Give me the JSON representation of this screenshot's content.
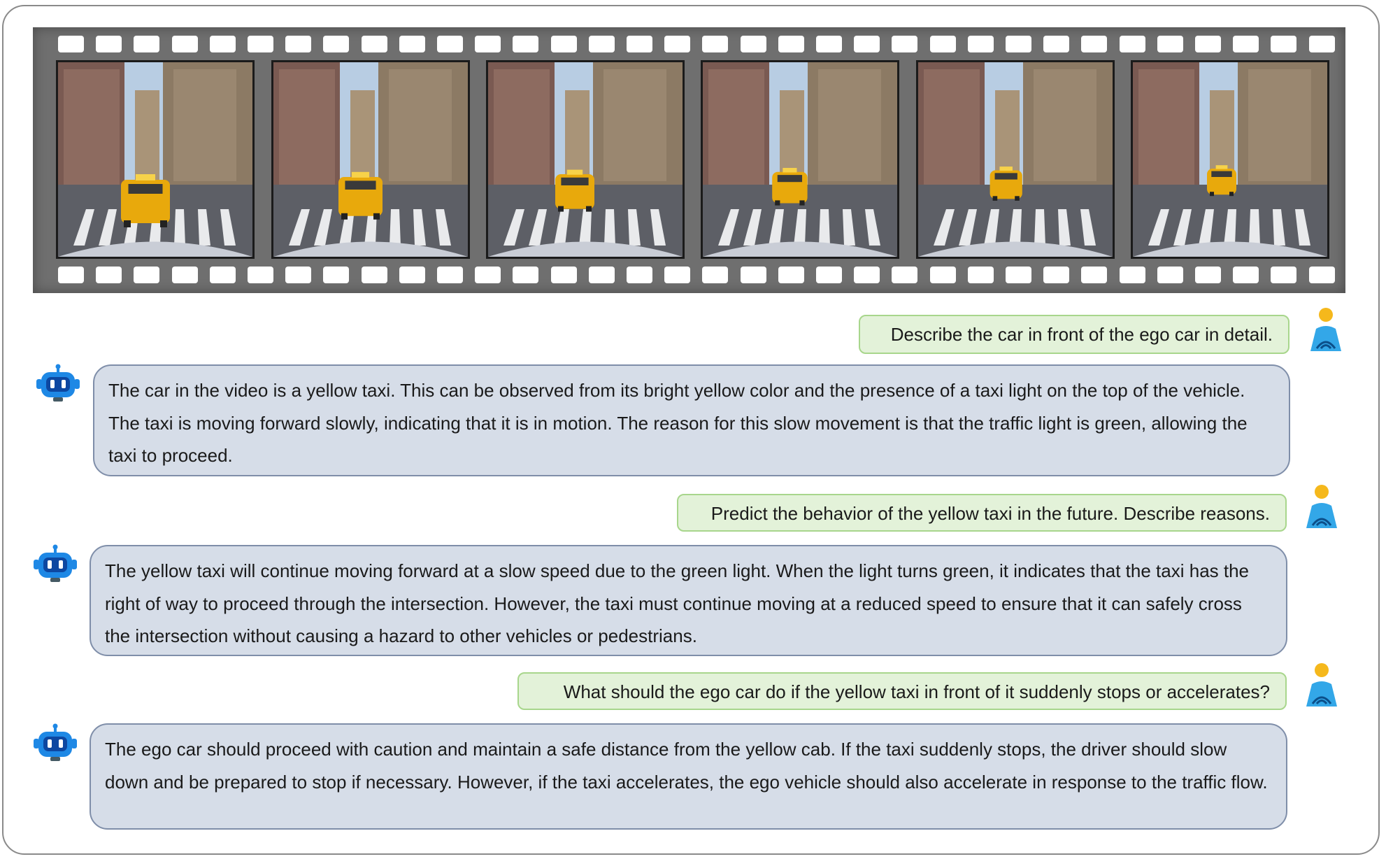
{
  "filmstrip": {
    "frame_count": 6,
    "frames": [
      {
        "label": "frame-1"
      },
      {
        "label": "frame-2"
      },
      {
        "label": "frame-3"
      },
      {
        "label": "frame-4"
      },
      {
        "label": "frame-5"
      },
      {
        "label": "frame-6"
      }
    ]
  },
  "conversation": [
    {
      "role": "user",
      "icon": "person-icon",
      "text": "Describe the car in front of the ego car in detail."
    },
    {
      "role": "assistant",
      "icon": "robot-icon",
      "text": "The car in the video is a yellow taxi. This can be observed from its bright yellow color and the presence of a taxi light on the top of the vehicle. The taxi is moving forward slowly, indicating that it is in motion. The reason for this slow movement is that the traffic light is green, allowing the taxi to proceed."
    },
    {
      "role": "user",
      "icon": "person-icon",
      "text": "Predict the behavior of the yellow taxi in the future. Describe reasons."
    },
    {
      "role": "assistant",
      "icon": "robot-icon",
      "text": "The yellow taxi will continue moving forward at a slow speed due to the green light. When the light turns green, it indicates that the taxi has the right of way to proceed through the intersection. However, the taxi must continue moving at a reduced speed to ensure that it can safely cross the intersection without causing a hazard to other vehicles or pedestrians."
    },
    {
      "role": "user",
      "icon": "person-icon",
      "text": "What should the ego car do if the yellow taxi in front of it suddenly stops or accelerates?"
    },
    {
      "role": "assistant",
      "icon": "robot-icon",
      "text": "The ego car should proceed with caution and maintain a safe distance from the yellow cab. If the taxi suddenly stops, the driver should slow down and be prepared to stop if necessary. However, if the taxi accelerates, the ego vehicle should also accelerate in response to the traffic flow."
    }
  ],
  "colors": {
    "user_bubble_bg": "#e3f2d9",
    "user_bubble_border": "#a8d68c",
    "assistant_bubble_bg": "#d6dde8",
    "assistant_bubble_border": "#7f8ea9",
    "filmstrip": "#6f6f6f",
    "taxi": "#e8a90c",
    "robot": "#1e88e5",
    "person_head": "#f5b81c",
    "person_body": "#33a7e8"
  }
}
